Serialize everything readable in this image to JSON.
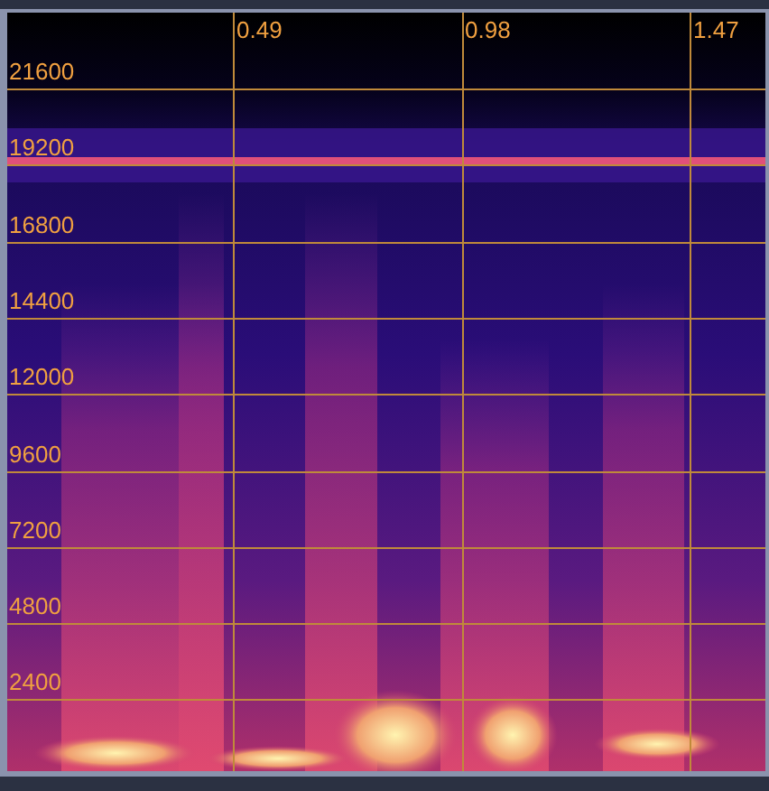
{
  "spectrogram": {
    "kind": "picture",
    "time_ticks": [
      "0.49",
      "0.98",
      "1.47"
    ],
    "frequency_ticks": [
      "21600",
      "19200",
      "16800",
      "14400",
      "12000",
      "9600",
      "7200",
      "4800",
      "2400"
    ]
  }
}
